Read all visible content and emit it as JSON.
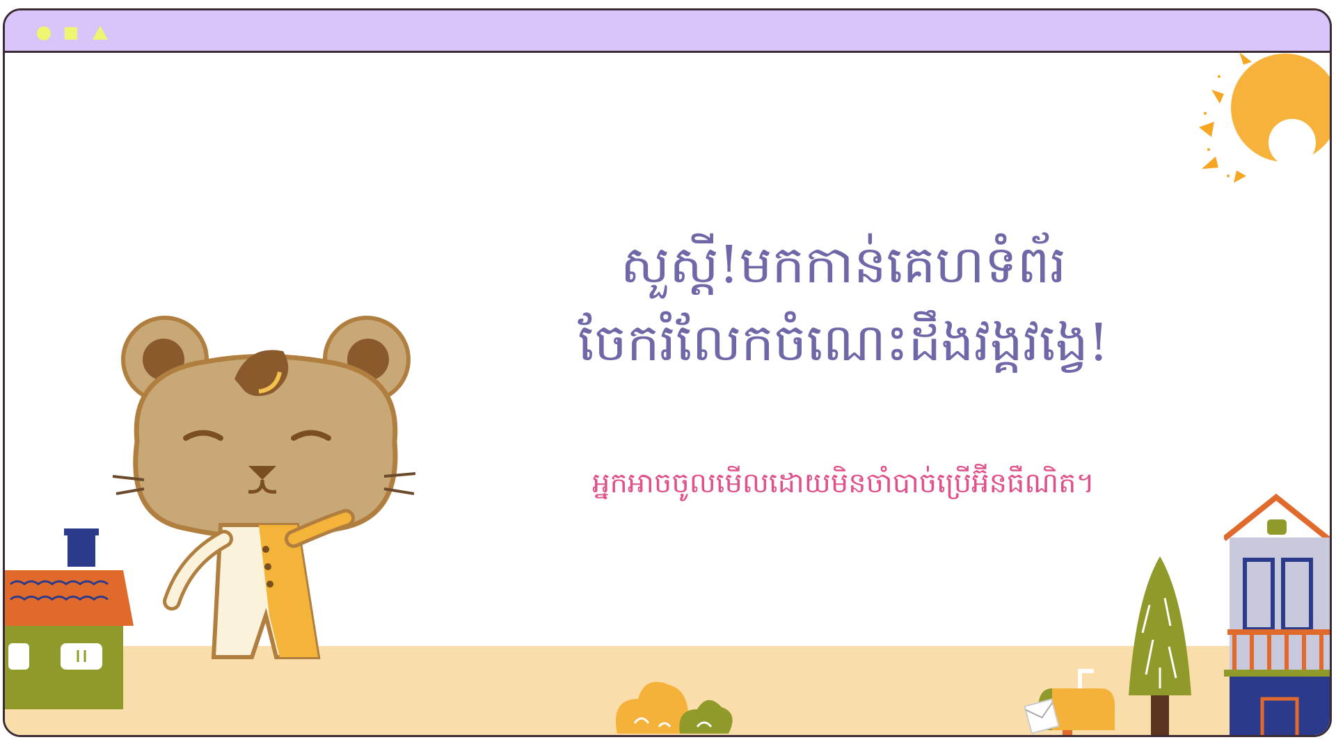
{
  "window": {
    "controls": [
      "circle-icon",
      "square-icon",
      "triangle-icon"
    ],
    "control_color": "#eef56f",
    "titlebar_color": "#d8c5fb"
  },
  "content": {
    "headline_line1": "សួស្តី!មកកាន់គេហទំព័រ",
    "headline_line2": "ចែករំលែកចំណេះដឹងវង្គវង្វេ!",
    "subtitle": "អ្នកអាចចូលមើលដោយមិនចាំបាច់ប្រើអ៊ីនធឺណិត។"
  },
  "colors": {
    "headline": "#6f68a8",
    "subtitle": "#e0508a",
    "ground": "#f9ddaa",
    "border": "#3b2a33"
  },
  "illustrations": [
    "sun-icon",
    "bear-character",
    "house-left",
    "house-right",
    "tree-icon",
    "mailbox-icon",
    "bush-icon"
  ]
}
